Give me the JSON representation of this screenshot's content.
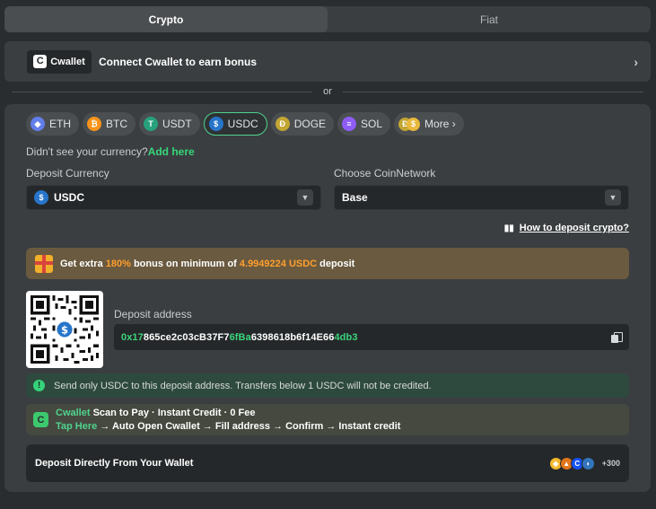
{
  "tabs": [
    {
      "label": "Crypto",
      "active": true
    },
    {
      "label": "Fiat",
      "active": false
    }
  ],
  "connect": {
    "logo_text": "Cwallet",
    "text": "Connect Cwallet to earn bonus"
  },
  "divider": {
    "text": "or"
  },
  "coins": [
    {
      "label": "ETH",
      "icon": "eth-icon",
      "color": "#627eea",
      "glyph": "◆"
    },
    {
      "label": "BTC",
      "icon": "btc-icon",
      "color": "#f7931a",
      "glyph": "₿"
    },
    {
      "label": "USDT",
      "icon": "usdt-icon",
      "color": "#26a17b",
      "glyph": "T"
    },
    {
      "label": "USDC",
      "icon": "usdc-icon",
      "color": "#2775ca",
      "glyph": "$",
      "selected": true
    },
    {
      "label": "DOGE",
      "icon": "doge-icon",
      "color": "#c2a633",
      "glyph": "Ð"
    },
    {
      "label": "SOL",
      "icon": "sol-icon",
      "color": "#8e5cf6",
      "glyph": "≡"
    },
    {
      "label": "More ›",
      "icon": "more-coins-icon"
    }
  ],
  "missing": {
    "text": "Didn't see your currency?",
    "link": "Add here"
  },
  "deposit_currency": {
    "label": "Deposit Currency",
    "value": "USDC"
  },
  "coin_network": {
    "label": "Choose CoinNetwork",
    "value": "Base"
  },
  "howto": {
    "text": "How to deposit crypto?"
  },
  "bonus": {
    "pre": "Get extra ",
    "percent": "180%",
    "mid": " bonus on minimum of ",
    "amount": "4.9949224 USDC",
    "post": " deposit"
  },
  "deposit": {
    "label": "Deposit address",
    "addr_start": "0x17",
    "addr_mid1": "865ce2c03cB37F7",
    "addr_hl": "6fBa",
    "addr_mid2": "6398618b6f14E66",
    "addr_end": "4db3"
  },
  "warning": {
    "text": "Send only USDC to this deposit address. Transfers below 1 USDC will not be credited."
  },
  "scan": {
    "line1_brand": "Cwallet",
    "line1_rest": " Scan to Pay · Instant Credit · 0 Fee",
    "line2_brand": "Tap Here",
    "line2_rest": " → Auto Open Cwallet → Fill address → Confirm → Instant credit"
  },
  "wallet": {
    "text": "Deposit Directly From Your Wallet",
    "count": "+300"
  }
}
